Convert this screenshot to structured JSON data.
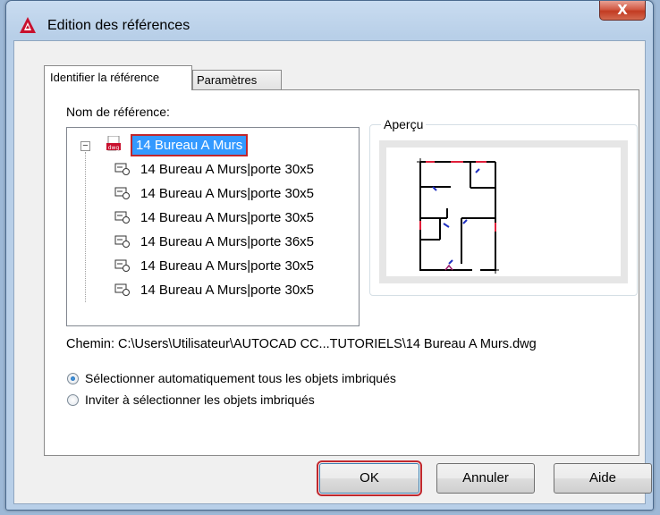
{
  "window": {
    "title": "Edition des références",
    "close_glyph": "X"
  },
  "tabs": [
    {
      "label": "Identifier la référence"
    },
    {
      "label": "Paramètres"
    }
  ],
  "reference": {
    "label": "Nom de référence:",
    "root": {
      "label": "14 Bureau A Murs",
      "icon": "dwg-file-icon"
    },
    "children": [
      {
        "label": "14 Bureau A Murs|porte 30x5",
        "icon": "block-reference-icon"
      },
      {
        "label": "14 Bureau A Murs|porte 30x5",
        "icon": "block-reference-icon"
      },
      {
        "label": "14 Bureau A Murs|porte 30x5",
        "icon": "block-reference-icon"
      },
      {
        "label": "14 Bureau A Murs|porte 36x5",
        "icon": "block-reference-icon"
      },
      {
        "label": "14 Bureau A Murs|porte 30x5",
        "icon": "block-reference-icon"
      },
      {
        "label": "14 Bureau A Murs|porte 30x5",
        "icon": "block-reference-icon"
      }
    ]
  },
  "preview": {
    "label": "Aperçu"
  },
  "path": {
    "label": "Chemin:",
    "value": "C:\\Users\\Utilisateur\\AUTOCAD CC...TUTORIELS\\14 Bureau A Murs.dwg"
  },
  "options": {
    "auto_select": {
      "label": "Sélectionner automatiquement tous les objets imbriqués",
      "checked": true
    },
    "prompt_select": {
      "label": "Inviter à sélectionner les objets imbriqués",
      "checked": false
    }
  },
  "buttons": {
    "ok": "OK",
    "cancel": "Annuler",
    "help": "Aide"
  },
  "colors": {
    "accent_red": "#c1272d",
    "selection_blue": "#3399ff"
  }
}
